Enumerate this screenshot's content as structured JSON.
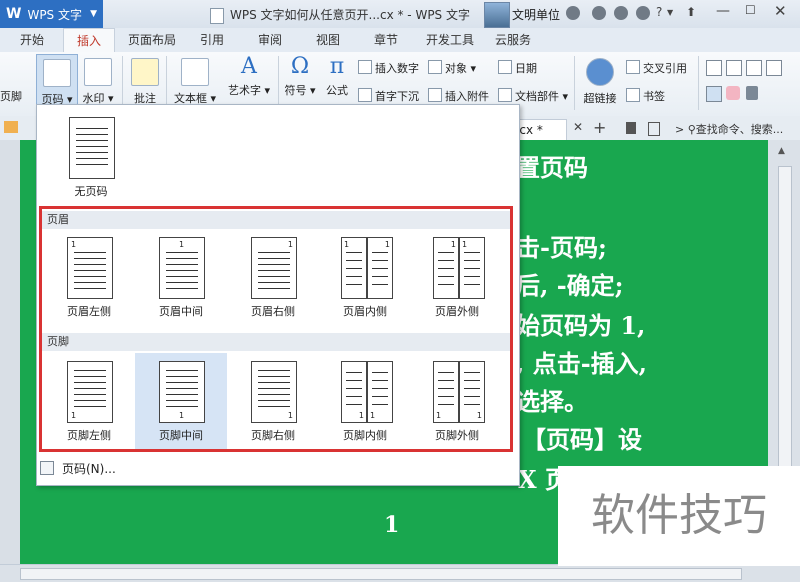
{
  "app": {
    "logo": "W",
    "name": "WPS 文字",
    "doc_title": "WPS 文字如何从任意页开...cx * - WPS 文字",
    "user": "文明单位"
  },
  "tabs": [
    "开始",
    "插入",
    "页面布局",
    "引用",
    "审阅",
    "视图",
    "章节",
    "开发工具",
    "云服务"
  ],
  "ribbon": {
    "left_cut": "页脚",
    "page_number": "页码",
    "watermark": "水印",
    "comment": "批注",
    "textbox": "文本框",
    "wordart": "艺术字",
    "symbol": "符号",
    "formula": "公式",
    "insert_number": "插入数字",
    "object": "对象",
    "date": "日期",
    "drop_cap": "首字下沉",
    "attachment": "插入附件",
    "doc_parts": "文档部件",
    "hyperlink": "超链接",
    "cross_ref": "交叉引用",
    "bookmark": "书签"
  },
  "doc_tab": {
    "label": "ocx *"
  },
  "search_hint": "查找命令、搜索...",
  "dropdown": {
    "none_label": "无页码",
    "header_section": "页眉",
    "footer_section": "页脚",
    "header_options": [
      "页眉左侧",
      "页眉中间",
      "页眉右侧",
      "页眉内侧",
      "页眉外侧"
    ],
    "footer_options": [
      "页脚左侧",
      "页脚中间",
      "页脚右侧",
      "页脚内侧",
      "页脚外侧"
    ],
    "page_num_item": "页码(N)...",
    "digit": "1"
  },
  "document": {
    "lines": [
      "置页码",
      "击-页码;",
      "后, -确定;",
      "始页码为 1,",
      ", 点击-插入,",
      "选择。",
      "【页码】设",
      "X 页"
    ],
    "bottom_number": "1"
  },
  "watermark_text": "软件技巧"
}
